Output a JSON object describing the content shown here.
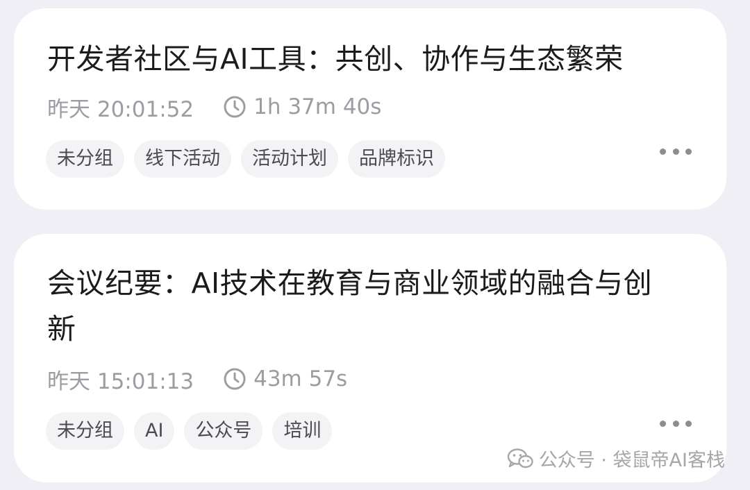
{
  "cards": [
    {
      "title": "开发者社区与AI工具：共创、协作与生态繁荣",
      "time": "昨天 20:01:52",
      "duration": "1h 37m 40s",
      "tags": [
        "未分组",
        "线下活动",
        "活动计划",
        "品牌标识"
      ]
    },
    {
      "title": "会议纪要：AI技术在教育与商业领域的融合与创新",
      "time": "昨天 15:01:13",
      "duration": "43m 57s",
      "tags": [
        "未分组",
        "AI",
        "公众号",
        "培训"
      ]
    }
  ],
  "watermark": {
    "text": "公众号 · 袋鼠帝AI客栈",
    "icon": "wechat-icon"
  },
  "icons": {
    "duration": "clock-icon",
    "more": "more-dots-icon"
  },
  "colors": {
    "background": "#efeff5",
    "card": "#ffffff",
    "title": "#1b1b1b",
    "meta": "#9c9ca2",
    "tag_bg": "#f3f3f5",
    "tag_text": "#4b4b50"
  }
}
